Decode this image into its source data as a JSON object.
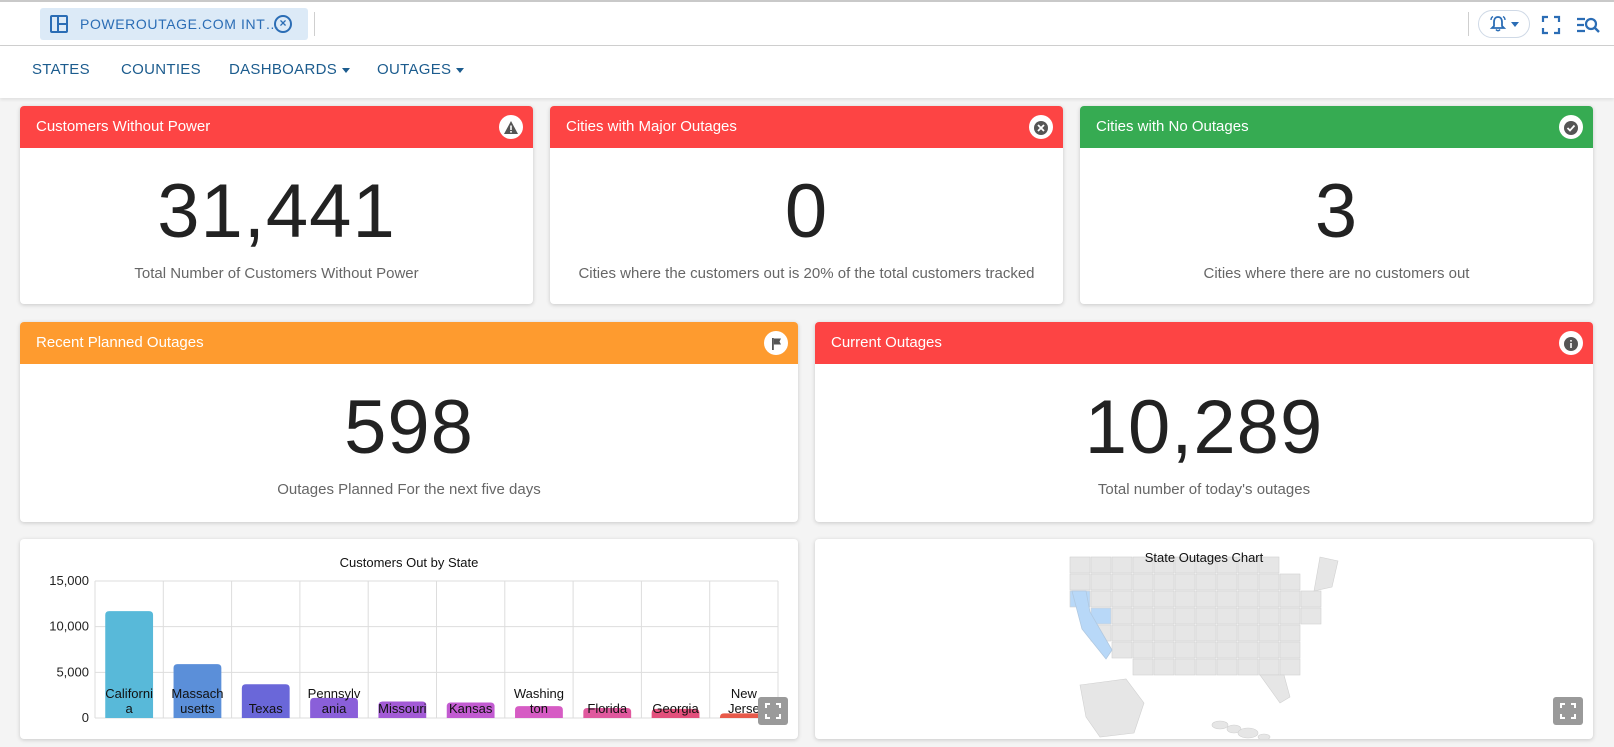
{
  "tab": {
    "title": "POWEROUTAGE.COM INT…"
  },
  "nav": {
    "items": [
      {
        "label": "STATES"
      },
      {
        "label": "COUNTIES"
      },
      {
        "label": "DASHBOARDS"
      },
      {
        "label": "OUTAGES"
      }
    ]
  },
  "cards": {
    "customers_without_power": {
      "title": "Customers Without Power",
      "value": "31,441",
      "subtitle": "Total Number of Customers Without Power",
      "color": "#fd4444"
    },
    "cities_major": {
      "title": "Cities with Major Outages",
      "value": "0",
      "subtitle": "Cities where the customers out is 20% of the total customers tracked",
      "color": "#fd4444"
    },
    "cities_none": {
      "title": "Cities with No Outages",
      "value": "3",
      "subtitle": "Cities where there are no customers out",
      "color": "#36ab52"
    },
    "planned": {
      "title": "Recent Planned Outages",
      "value": "598",
      "subtitle": "Outages Planned For the next five days",
      "color": "#fe9b2f"
    },
    "current": {
      "title": "Current Outages",
      "value": "10,289",
      "subtitle": "Total number of today's outages",
      "color": "#fd4444"
    }
  },
  "chart_data": {
    "type": "bar",
    "title": "Customers Out by State",
    "categories": [
      "Californi a",
      "Massach usetts",
      "Texas",
      "Pennsylv ania",
      "Missouri",
      "Kansas",
      "Washing ton",
      "Florida",
      "Georgia",
      "New Jerse"
    ],
    "values": [
      11700,
      5900,
      3700,
      2200,
      1800,
      1700,
      1300,
      1100,
      1000,
      500
    ],
    "colors": [
      "#58b9d9",
      "#5b8fd9",
      "#6a67d9",
      "#8a5fd9",
      "#a35bd6",
      "#c25bd1",
      "#d65cc4",
      "#e0599e",
      "#e3507c",
      "#e85a4a"
    ],
    "ylim": [
      0,
      15000
    ],
    "yticks": [
      "0",
      "5,000",
      "10,000",
      "15,000"
    ],
    "xlabel": "",
    "ylabel": "",
    "grid": true
  },
  "map": {
    "title": "State Outages Chart",
    "highlight_color": "#b8d8f8",
    "base_color": "#e6e6e6"
  }
}
